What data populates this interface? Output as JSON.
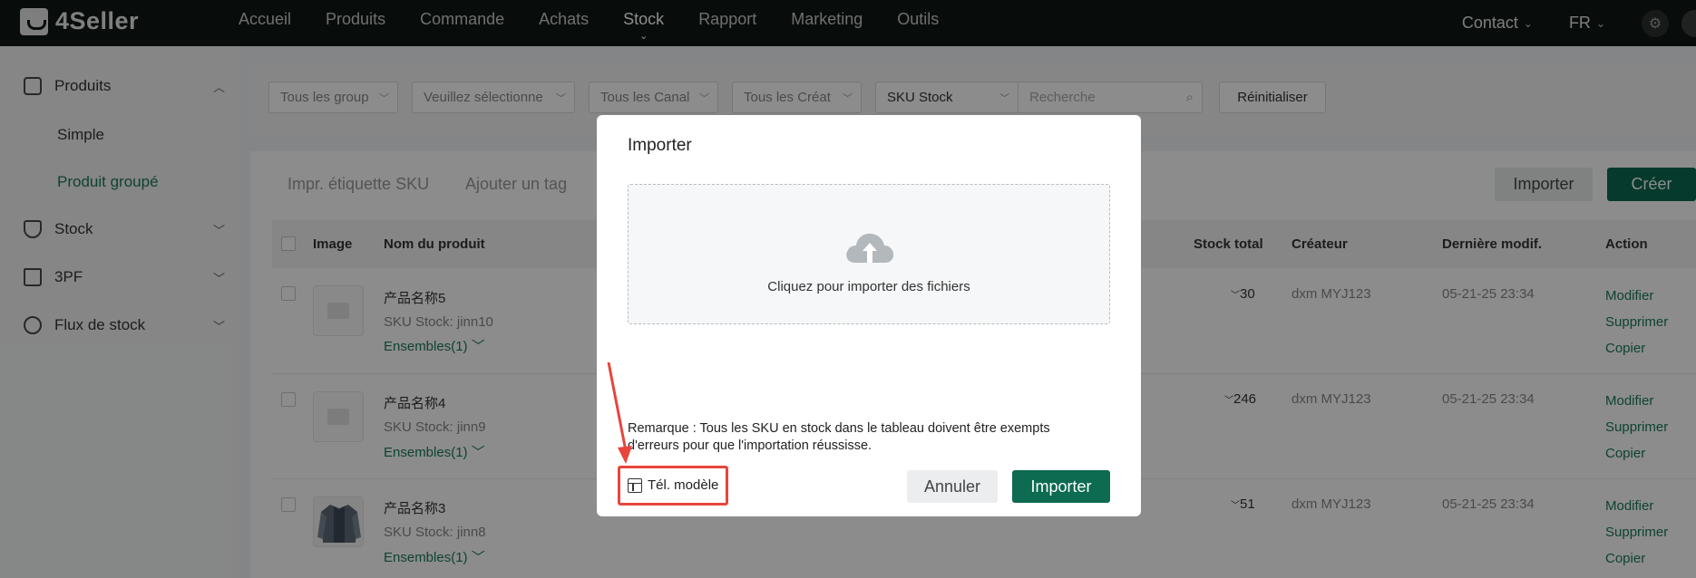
{
  "app": {
    "logo_text": "4Seller",
    "accent_color": "#0c6b50",
    "link_color": "#1a7a55"
  },
  "topnav": {
    "items": [
      {
        "label": "Accueil"
      },
      {
        "label": "Produits"
      },
      {
        "label": "Commande"
      },
      {
        "label": "Achats"
      },
      {
        "label": "Stock"
      },
      {
        "label": "Rapport"
      },
      {
        "label": "Marketing"
      },
      {
        "label": "Outils"
      }
    ],
    "active": "Stock",
    "contact_label": "Contact",
    "lang_label": "FR",
    "settings_icon": "gear-icon"
  },
  "sidebar": {
    "produits_label": "Produits",
    "simple_label": "Simple",
    "groupe_label": "Produit groupé",
    "stock_label": "Stock",
    "pf_label": "3PF",
    "flux_label": "Flux de stock"
  },
  "filters": {
    "group": "Tous les group",
    "select": "Veuillez sélectionne",
    "channel": "Tous les Canal",
    "creator": "Tous les Créat",
    "sku_type": "SKU Stock",
    "search_placeholder": "Recherche",
    "reset_label": "Réinitialiser"
  },
  "toolbar": {
    "print_label": "Impr. étiquette SKU",
    "tag_label": "Ajouter un tag",
    "import_label": "Importer",
    "create_label": "Créer"
  },
  "table": {
    "headers": {
      "image": "Image",
      "name": "Nom du produit",
      "stock_total": "Stock total",
      "creator": "Créateur",
      "modified": "Dernière modif.",
      "action": "Action"
    },
    "rows": [
      {
        "name": "产品名称5",
        "sku": "SKU Stock: jinn10",
        "bundles": "Ensembles(1)",
        "stock": "30",
        "creator": "dxm MYJ123",
        "modified": "05-21-25 23:34"
      },
      {
        "name": "产品名称4",
        "sku": "SKU Stock: jinn9",
        "bundles": "Ensembles(1)",
        "stock": "246",
        "creator": "dxm MYJ123",
        "modified": "05-21-25 23:34"
      },
      {
        "name": "产品名称3",
        "sku": "SKU Stock: jinn8",
        "bundles": "Ensembles(1)",
        "stock": "51",
        "creator": "dxm MYJ123",
        "modified": "05-21-25 23:34"
      }
    ],
    "actions": {
      "edit": "Modifier",
      "delete": "Supprimer",
      "copy": "Copier"
    }
  },
  "modal": {
    "title": "Importer",
    "upload_text": "Cliquez pour importer des fichiers",
    "note": "Remarque : Tous les SKU en stock dans le tableau doivent être exempts d'erreurs pour que l'importation réussisse.",
    "template_label": "Tél. modèle",
    "cancel_label": "Annuler",
    "import_label": "Importer",
    "highlight_color": "#e8453c"
  }
}
